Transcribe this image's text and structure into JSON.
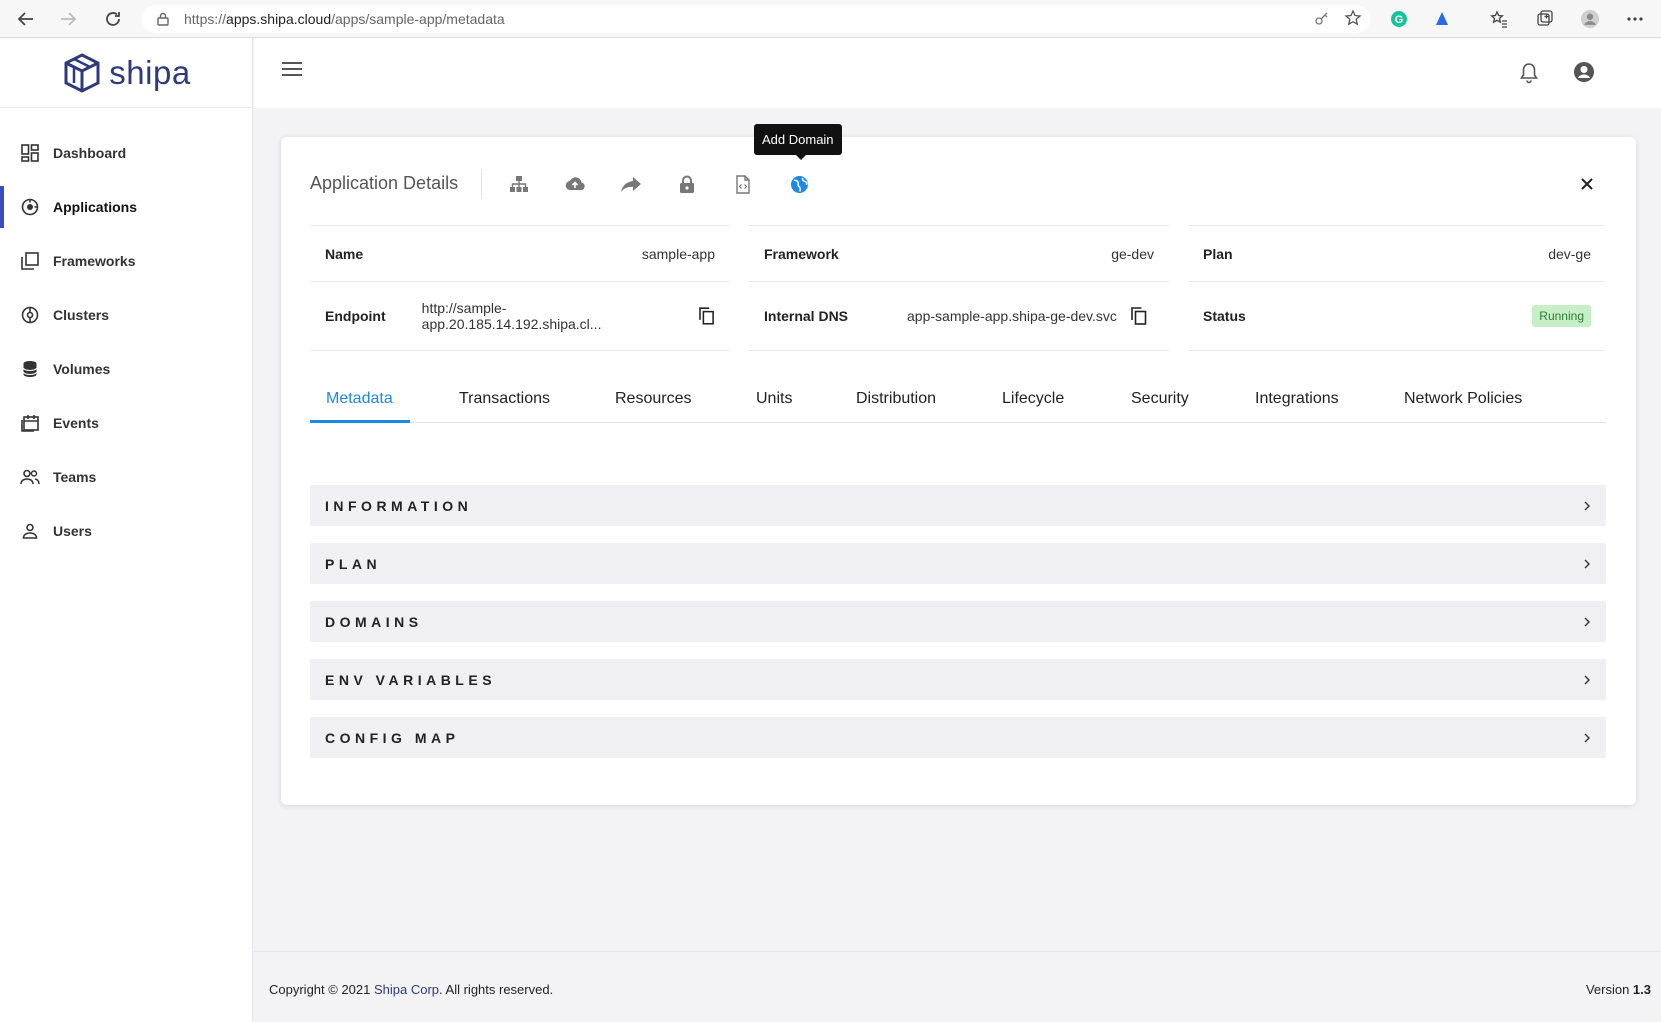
{
  "browser": {
    "url_prefix": "https://",
    "url_host": "apps.shipa.cloud",
    "url_path": "/apps/sample-app/metadata"
  },
  "brand": {
    "logo_text": "shipa",
    "logo_color": "#2e3a7a"
  },
  "sidebar": {
    "items": [
      {
        "label": "Dashboard",
        "icon": "dashboard-icon"
      },
      {
        "label": "Applications",
        "icon": "applications-icon",
        "active": true
      },
      {
        "label": "Frameworks",
        "icon": "frameworks-icon"
      },
      {
        "label": "Clusters",
        "icon": "clusters-icon"
      },
      {
        "label": "Volumes",
        "icon": "volumes-icon"
      },
      {
        "label": "Events",
        "icon": "events-icon"
      },
      {
        "label": "Teams",
        "icon": "teams-icon"
      },
      {
        "label": "Users",
        "icon": "users-icon"
      }
    ]
  },
  "card": {
    "title": "Application Details",
    "tooltip": "Add Domain",
    "fields": {
      "name_label": "Name",
      "name_value": "sample-app",
      "framework_label": "Framework",
      "framework_value": "ge-dev",
      "plan_label": "Plan",
      "plan_value": "dev-ge",
      "endpoint_label": "Endpoint",
      "endpoint_value": "http://sample-app.20.185.14.192.shipa.cl...",
      "dns_label": "Internal DNS",
      "dns_value": "app-sample-app.shipa-ge-dev.svc",
      "status_label": "Status",
      "status_value": "Running"
    },
    "tabs": [
      "Metadata",
      "Transactions",
      "Resources",
      "Units",
      "Distribution",
      "Lifecycle",
      "Security",
      "Integrations",
      "Network Policies"
    ],
    "active_tab": "Metadata",
    "sections": [
      "INFORMATION",
      "PLAN",
      "DOMAINS",
      "ENV VARIABLES",
      "CONFIG MAP"
    ]
  },
  "footer": {
    "copyright_prefix": "Copyright © 2021 ",
    "corp": "Shipa Corp",
    "copyright_suffix": ". All rights reserved.",
    "version_label": "Version ",
    "version_number": "1.3"
  },
  "colors": {
    "accent": "#1e88e5",
    "active_nav": "#3b4cc0",
    "running_bg": "#c6efc7",
    "running_fg": "#2e7d32"
  }
}
